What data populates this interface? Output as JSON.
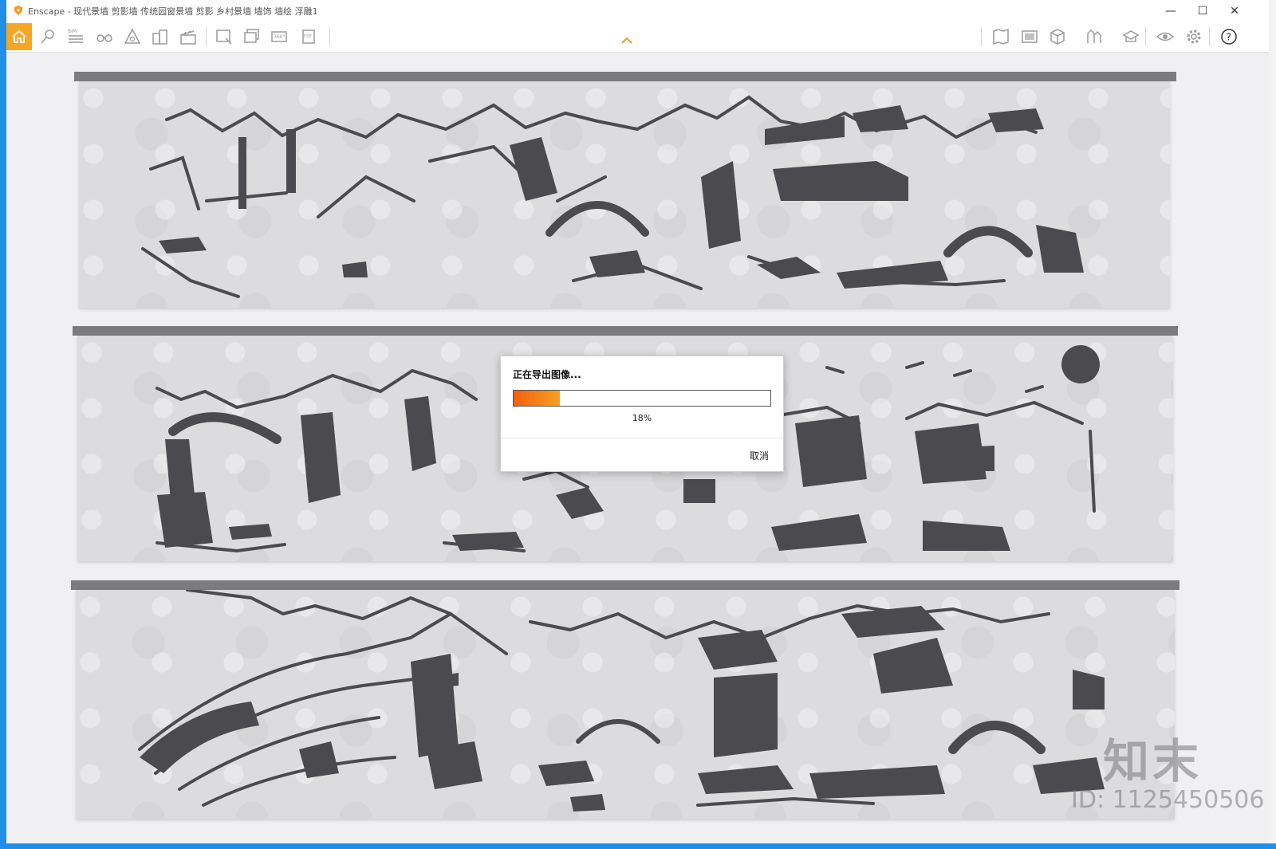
{
  "window": {
    "title": "Enscape - 现代景墙 剪影墙 传统园窗景墙 剪影 乡村景墙 墙饰 墙绘 浮雕1",
    "controls": {
      "minimize": "—",
      "maximize": "☐",
      "close": "✕"
    }
  },
  "toolbar": {
    "left_icons": [
      "home-icon",
      "location-icon",
      "bim-icon",
      "binoculars-icon",
      "atmosphere-icon",
      "buildings-icon",
      "clapperboard-icon",
      "screenshot-icon",
      "batch-render-icon",
      "panorama-360-icon",
      "export-exe-icon"
    ],
    "bim_label": "BIM",
    "pano_label": "360°",
    "exe_label": "EXE",
    "right_icons": [
      "map-icon",
      "gallery-icon",
      "cube-icon",
      "materials-icon",
      "asset-library-icon",
      "visibility-icon",
      "settings-icon",
      "help-icon"
    ],
    "help_label": "?"
  },
  "dialog": {
    "title": "正在导出图像...",
    "progress": 0.18,
    "progress_text": "18%",
    "cancel_label": "取消"
  },
  "watermark": {
    "logo_text": "知末",
    "id_text": "ID: 1125450506"
  },
  "colors": {
    "accent": "#f6a623",
    "progress_start": "#f06010",
    "progress_end": "#f8a020",
    "silhouette": "#4a4a4f",
    "desktop": "#1f8fe8"
  }
}
